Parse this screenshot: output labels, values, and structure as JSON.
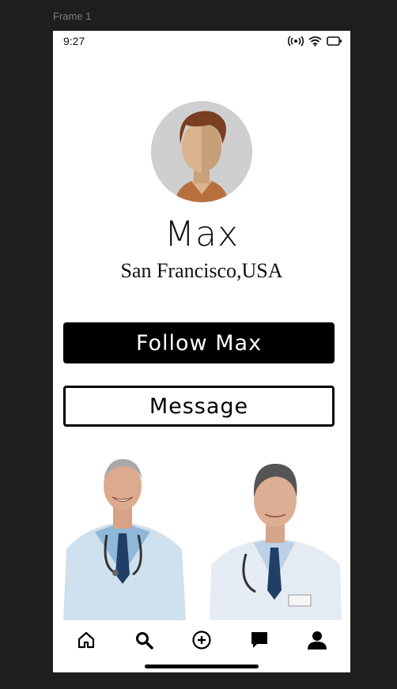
{
  "frame": {
    "label": "Frame 1"
  },
  "status_bar": {
    "time": "9:27",
    "icons": [
      "broadcast-icon",
      "wifi-icon",
      "battery-icon"
    ]
  },
  "profile": {
    "name": "Max",
    "location": "San Francisco,USA",
    "avatar_icon": "avatar-illustration"
  },
  "actions": {
    "follow_label": "Follow Max",
    "message_label": "Message"
  },
  "photos": [
    {
      "icon": "doctor-photo-smiling"
    },
    {
      "icon": "doctor-photo-portrait"
    }
  ],
  "bottom_nav": {
    "items": [
      "home-icon",
      "search-icon",
      "add-circle-icon",
      "chat-icon",
      "profile-icon"
    ]
  },
  "colors": {
    "frame_bg": "#1e1e1e",
    "screen_bg": "#ffffff",
    "primary": "#000000"
  }
}
